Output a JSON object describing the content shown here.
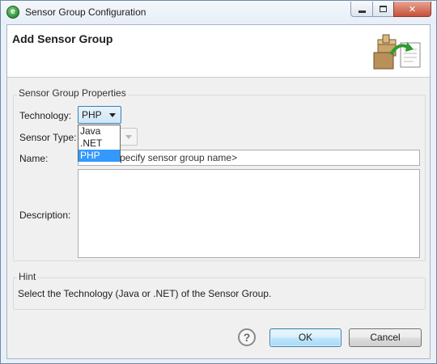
{
  "window": {
    "title": "Sensor Group Configuration",
    "icon": "app-logo-icon"
  },
  "header": {
    "title": "Add Sensor Group",
    "graphic": "package-wizard-icon"
  },
  "properties": {
    "group_label": "Sensor Group Properties",
    "technology": {
      "label": "Technology:",
      "value": "PHP",
      "options": [
        "Java",
        ".NET",
        "PHP"
      ],
      "selected_index": 2
    },
    "sensor_type": {
      "label": "Sensor Type:",
      "value": ""
    },
    "name": {
      "label": "Name:",
      "value": "<specify sensor group name>",
      "visible_value": "pecify sensor group name>"
    },
    "description": {
      "label": "Description:",
      "value": ""
    }
  },
  "hint": {
    "group_label": "Hint",
    "text": "Select the Technology (Java or .NET) of the Sensor Group."
  },
  "buttons": {
    "help_symbol": "?",
    "ok": "OK",
    "cancel": "Cancel"
  },
  "colors": {
    "accent": "#3399ff",
    "default_button_border": "#3c7fb1",
    "dialog_bg": "#f0f0f0"
  }
}
